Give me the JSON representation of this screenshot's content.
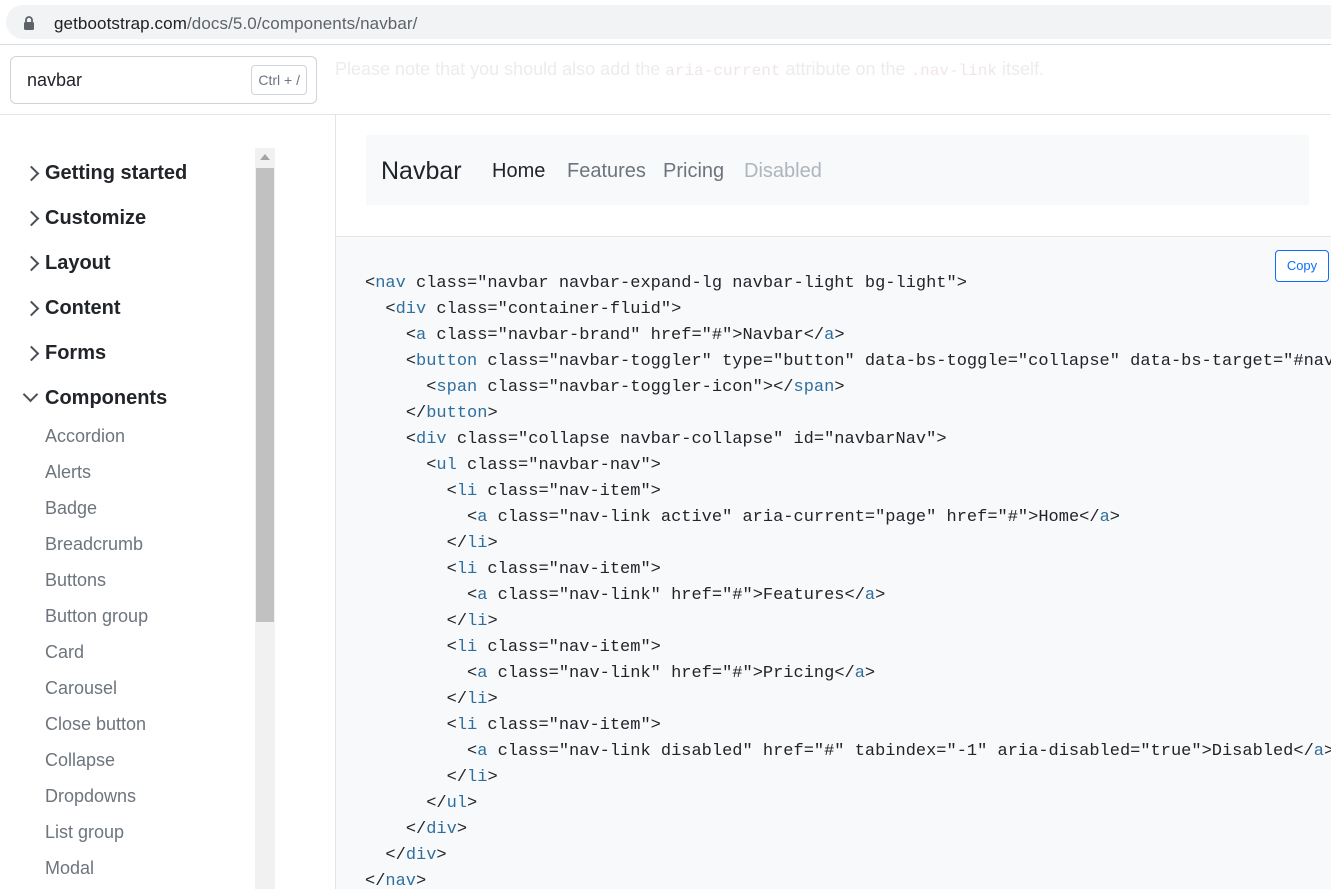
{
  "browser": {
    "url_host": "getbootstrap.com",
    "url_path": "/docs/5.0/components/navbar/"
  },
  "search": {
    "value": "navbar",
    "shortcut": "Ctrl + /"
  },
  "faded_note": {
    "before": "Please note that you should also add the ",
    "code1": "aria-current",
    "middle": " attribute on the ",
    "code2": ".nav-link",
    "after": " itself."
  },
  "sidebar": {
    "sections": [
      {
        "label": "Getting started",
        "expanded": false
      },
      {
        "label": "Customize",
        "expanded": false
      },
      {
        "label": "Layout",
        "expanded": false
      },
      {
        "label": "Content",
        "expanded": false
      },
      {
        "label": "Forms",
        "expanded": false
      },
      {
        "label": "Components",
        "expanded": true
      }
    ],
    "components": [
      "Accordion",
      "Alerts",
      "Badge",
      "Breadcrumb",
      "Buttons",
      "Button group",
      "Card",
      "Carousel",
      "Close button",
      "Collapse",
      "Dropdowns",
      "List group",
      "Modal"
    ]
  },
  "example": {
    "brand": "Navbar",
    "links": [
      {
        "label": "Home",
        "state": "active"
      },
      {
        "label": "Features",
        "state": "normal"
      },
      {
        "label": "Pricing",
        "state": "normal"
      },
      {
        "label": "Disabled",
        "state": "disabled"
      }
    ]
  },
  "code": {
    "copy_label": "Copy",
    "lines": [
      "<nav class=\"navbar navbar-expand-lg navbar-light bg-light\">",
      "  <div class=\"container-fluid\">",
      "    <a class=\"navbar-brand\" href=\"#\">Navbar</a>",
      "    <button class=\"navbar-toggler\" type=\"button\" data-bs-toggle=\"collapse\" data-bs-target=\"#navbarN",
      "      <span class=\"navbar-toggler-icon\"></span>",
      "    </button>",
      "    <div class=\"collapse navbar-collapse\" id=\"navbarNav\">",
      "      <ul class=\"navbar-nav\">",
      "        <li class=\"nav-item\">",
      "          <a class=\"nav-link active\" aria-current=\"page\" href=\"#\">Home</a>",
      "        </li>",
      "        <li class=\"nav-item\">",
      "          <a class=\"nav-link\" href=\"#\">Features</a>",
      "        </li>",
      "        <li class=\"nav-item\">",
      "          <a class=\"nav-link\" href=\"#\">Pricing</a>",
      "        </li>",
      "        <li class=\"nav-item\">",
      "          <a class=\"nav-link disabled\" href=\"#\" tabindex=\"-1\" aria-disabled=\"true\">Disabled</a>",
      "        </li>",
      "      </ul>",
      "    </div>",
      "  </div>",
      "</nav>"
    ]
  }
}
